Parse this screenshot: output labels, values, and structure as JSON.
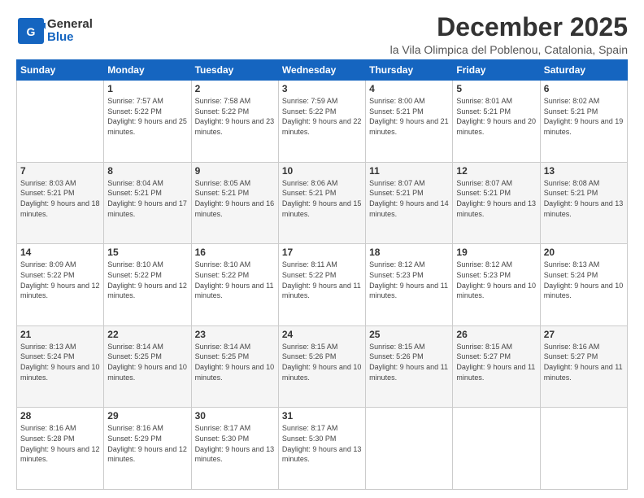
{
  "header": {
    "logo_general": "General",
    "logo_blue": "Blue",
    "main_title": "December 2025",
    "subtitle": "la Vila Olimpica del Poblenou, Catalonia, Spain"
  },
  "days_of_week": [
    "Sunday",
    "Monday",
    "Tuesday",
    "Wednesday",
    "Thursday",
    "Friday",
    "Saturday"
  ],
  "weeks": [
    [
      {
        "day": "",
        "sunrise": "",
        "sunset": "",
        "daylight": ""
      },
      {
        "day": "1",
        "sunrise": "Sunrise: 7:57 AM",
        "sunset": "Sunset: 5:22 PM",
        "daylight": "Daylight: 9 hours and 25 minutes."
      },
      {
        "day": "2",
        "sunrise": "Sunrise: 7:58 AM",
        "sunset": "Sunset: 5:22 PM",
        "daylight": "Daylight: 9 hours and 23 minutes."
      },
      {
        "day": "3",
        "sunrise": "Sunrise: 7:59 AM",
        "sunset": "Sunset: 5:22 PM",
        "daylight": "Daylight: 9 hours and 22 minutes."
      },
      {
        "day": "4",
        "sunrise": "Sunrise: 8:00 AM",
        "sunset": "Sunset: 5:21 PM",
        "daylight": "Daylight: 9 hours and 21 minutes."
      },
      {
        "day": "5",
        "sunrise": "Sunrise: 8:01 AM",
        "sunset": "Sunset: 5:21 PM",
        "daylight": "Daylight: 9 hours and 20 minutes."
      },
      {
        "day": "6",
        "sunrise": "Sunrise: 8:02 AM",
        "sunset": "Sunset: 5:21 PM",
        "daylight": "Daylight: 9 hours and 19 minutes."
      }
    ],
    [
      {
        "day": "7",
        "sunrise": "Sunrise: 8:03 AM",
        "sunset": "Sunset: 5:21 PM",
        "daylight": "Daylight: 9 hours and 18 minutes."
      },
      {
        "day": "8",
        "sunrise": "Sunrise: 8:04 AM",
        "sunset": "Sunset: 5:21 PM",
        "daylight": "Daylight: 9 hours and 17 minutes."
      },
      {
        "day": "9",
        "sunrise": "Sunrise: 8:05 AM",
        "sunset": "Sunset: 5:21 PM",
        "daylight": "Daylight: 9 hours and 16 minutes."
      },
      {
        "day": "10",
        "sunrise": "Sunrise: 8:06 AM",
        "sunset": "Sunset: 5:21 PM",
        "daylight": "Daylight: 9 hours and 15 minutes."
      },
      {
        "day": "11",
        "sunrise": "Sunrise: 8:07 AM",
        "sunset": "Sunset: 5:21 PM",
        "daylight": "Daylight: 9 hours and 14 minutes."
      },
      {
        "day": "12",
        "sunrise": "Sunrise: 8:07 AM",
        "sunset": "Sunset: 5:21 PM",
        "daylight": "Daylight: 9 hours and 13 minutes."
      },
      {
        "day": "13",
        "sunrise": "Sunrise: 8:08 AM",
        "sunset": "Sunset: 5:21 PM",
        "daylight": "Daylight: 9 hours and 13 minutes."
      }
    ],
    [
      {
        "day": "14",
        "sunrise": "Sunrise: 8:09 AM",
        "sunset": "Sunset: 5:22 PM",
        "daylight": "Daylight: 9 hours and 12 minutes."
      },
      {
        "day": "15",
        "sunrise": "Sunrise: 8:10 AM",
        "sunset": "Sunset: 5:22 PM",
        "daylight": "Daylight: 9 hours and 12 minutes."
      },
      {
        "day": "16",
        "sunrise": "Sunrise: 8:10 AM",
        "sunset": "Sunset: 5:22 PM",
        "daylight": "Daylight: 9 hours and 11 minutes."
      },
      {
        "day": "17",
        "sunrise": "Sunrise: 8:11 AM",
        "sunset": "Sunset: 5:22 PM",
        "daylight": "Daylight: 9 hours and 11 minutes."
      },
      {
        "day": "18",
        "sunrise": "Sunrise: 8:12 AM",
        "sunset": "Sunset: 5:23 PM",
        "daylight": "Daylight: 9 hours and 11 minutes."
      },
      {
        "day": "19",
        "sunrise": "Sunrise: 8:12 AM",
        "sunset": "Sunset: 5:23 PM",
        "daylight": "Daylight: 9 hours and 10 minutes."
      },
      {
        "day": "20",
        "sunrise": "Sunrise: 8:13 AM",
        "sunset": "Sunset: 5:24 PM",
        "daylight": "Daylight: 9 hours and 10 minutes."
      }
    ],
    [
      {
        "day": "21",
        "sunrise": "Sunrise: 8:13 AM",
        "sunset": "Sunset: 5:24 PM",
        "daylight": "Daylight: 9 hours and 10 minutes."
      },
      {
        "day": "22",
        "sunrise": "Sunrise: 8:14 AM",
        "sunset": "Sunset: 5:25 PM",
        "daylight": "Daylight: 9 hours and 10 minutes."
      },
      {
        "day": "23",
        "sunrise": "Sunrise: 8:14 AM",
        "sunset": "Sunset: 5:25 PM",
        "daylight": "Daylight: 9 hours and 10 minutes."
      },
      {
        "day": "24",
        "sunrise": "Sunrise: 8:15 AM",
        "sunset": "Sunset: 5:26 PM",
        "daylight": "Daylight: 9 hours and 10 minutes."
      },
      {
        "day": "25",
        "sunrise": "Sunrise: 8:15 AM",
        "sunset": "Sunset: 5:26 PM",
        "daylight": "Daylight: 9 hours and 11 minutes."
      },
      {
        "day": "26",
        "sunrise": "Sunrise: 8:15 AM",
        "sunset": "Sunset: 5:27 PM",
        "daylight": "Daylight: 9 hours and 11 minutes."
      },
      {
        "day": "27",
        "sunrise": "Sunrise: 8:16 AM",
        "sunset": "Sunset: 5:27 PM",
        "daylight": "Daylight: 9 hours and 11 minutes."
      }
    ],
    [
      {
        "day": "28",
        "sunrise": "Sunrise: 8:16 AM",
        "sunset": "Sunset: 5:28 PM",
        "daylight": "Daylight: 9 hours and 12 minutes."
      },
      {
        "day": "29",
        "sunrise": "Sunrise: 8:16 AM",
        "sunset": "Sunset: 5:29 PM",
        "daylight": "Daylight: 9 hours and 12 minutes."
      },
      {
        "day": "30",
        "sunrise": "Sunrise: 8:17 AM",
        "sunset": "Sunset: 5:30 PM",
        "daylight": "Daylight: 9 hours and 13 minutes."
      },
      {
        "day": "31",
        "sunrise": "Sunrise: 8:17 AM",
        "sunset": "Sunset: 5:30 PM",
        "daylight": "Daylight: 9 hours and 13 minutes."
      },
      {
        "day": "",
        "sunrise": "",
        "sunset": "",
        "daylight": ""
      },
      {
        "day": "",
        "sunrise": "",
        "sunset": "",
        "daylight": ""
      },
      {
        "day": "",
        "sunrise": "",
        "sunset": "",
        "daylight": ""
      }
    ]
  ]
}
